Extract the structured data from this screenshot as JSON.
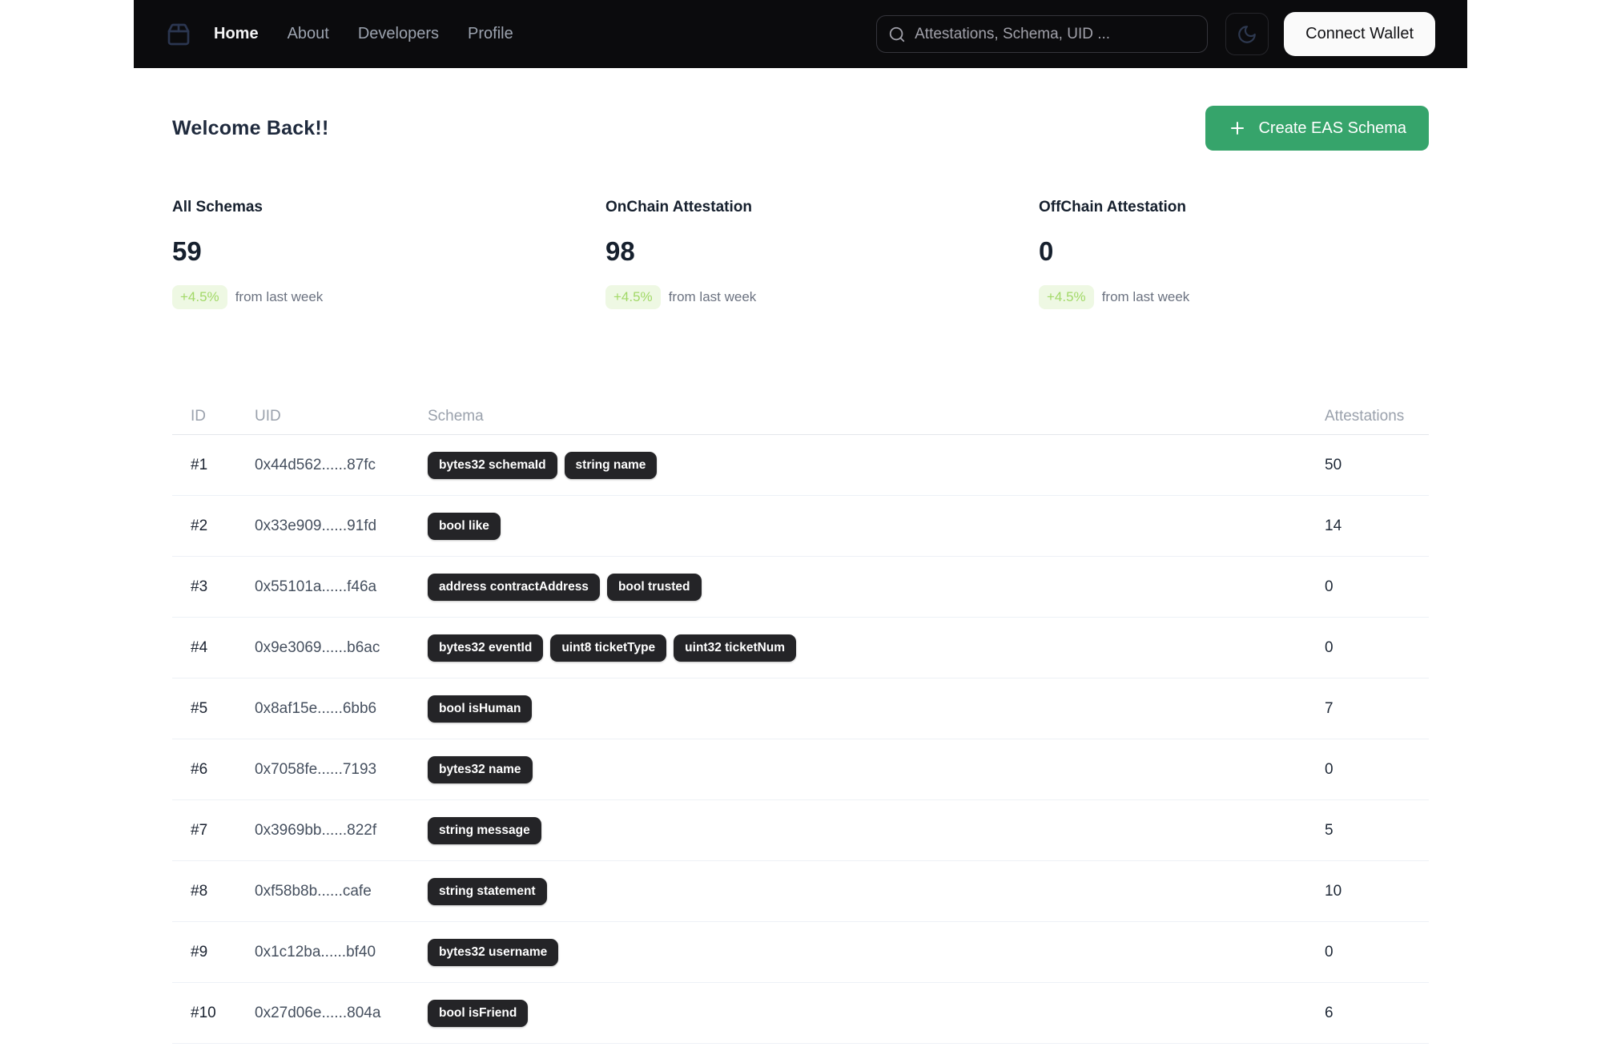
{
  "colors": {
    "navbar_bg": "#0b0b0d",
    "accent_green": "#36a46b",
    "badge_bg": "#242427",
    "delta_bg": "#eef8e3",
    "delta_text": "#a2d968"
  },
  "navbar": {
    "logo_icon": "package-icon",
    "items": [
      {
        "label": "Home",
        "active": true
      },
      {
        "label": "About",
        "active": false
      },
      {
        "label": "Developers",
        "active": false
      },
      {
        "label": "Profile",
        "active": false
      }
    ],
    "search_placeholder": "Attestations, Schema, UID ...",
    "theme_toggle_icon": "moon-icon",
    "connect_wallet_label": "Connect Wallet"
  },
  "header": {
    "title": "Welcome Back!!",
    "create_button_label": "Create EAS Schema",
    "create_button_icon": "plus-icon"
  },
  "stats": [
    {
      "label": "All Schemas",
      "value": "59",
      "delta": "+4.5%",
      "delta_suffix": "from last week"
    },
    {
      "label": "OnChain Attestation",
      "value": "98",
      "delta": "+4.5%",
      "delta_suffix": "from last week"
    },
    {
      "label": "OffChain Attestation",
      "value": "0",
      "delta": "+4.5%",
      "delta_suffix": "from last week"
    }
  ],
  "table": {
    "columns": [
      "ID",
      "UID",
      "Schema",
      "Attestations"
    ],
    "rows": [
      {
        "id": "#1",
        "uid": "0x44d562......87fc",
        "schema": [
          "bytes32 schemaId",
          "string name"
        ],
        "attestations": "50"
      },
      {
        "id": "#2",
        "uid": "0x33e909......91fd",
        "schema": [
          "bool like"
        ],
        "attestations": "14"
      },
      {
        "id": "#3",
        "uid": "0x55101a......f46a",
        "schema": [
          "address contractAddress",
          "bool trusted"
        ],
        "attestations": "0"
      },
      {
        "id": "#4",
        "uid": "0x9e3069......b6ac",
        "schema": [
          "bytes32 eventId",
          "uint8 ticketType",
          "uint32 ticketNum"
        ],
        "attestations": "0"
      },
      {
        "id": "#5",
        "uid": "0x8af15e......6bb6",
        "schema": [
          "bool isHuman"
        ],
        "attestations": "7"
      },
      {
        "id": "#6",
        "uid": "0x7058fe......7193",
        "schema": [
          "bytes32 name"
        ],
        "attestations": "0"
      },
      {
        "id": "#7",
        "uid": "0x3969bb......822f",
        "schema": [
          "string message"
        ],
        "attestations": "5"
      },
      {
        "id": "#8",
        "uid": "0xf58b8b......cafe",
        "schema": [
          "string statement"
        ],
        "attestations": "10"
      },
      {
        "id": "#9",
        "uid": "0x1c12ba......bf40",
        "schema": [
          "bytes32 username"
        ],
        "attestations": "0"
      },
      {
        "id": "#10",
        "uid": "0x27d06e......804a",
        "schema": [
          "bool isFriend"
        ],
        "attestations": "6"
      }
    ]
  }
}
